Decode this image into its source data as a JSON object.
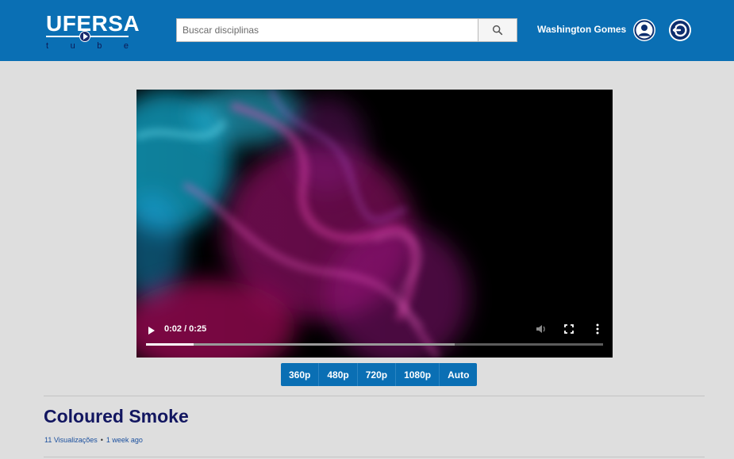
{
  "header": {
    "logo_text": "UFERSA",
    "logo_sub": [
      "t",
      "u",
      "b",
      "e"
    ],
    "search_placeholder": "Buscar disciplinas",
    "username": "Washington Gomes",
    "icons": {
      "search": "search-icon",
      "profile": "user-icon",
      "logout": "logout-icon"
    }
  },
  "player": {
    "time": "0:02 / 0:25",
    "progress": 0.104,
    "buffered": 0.675
  },
  "quality_options": [
    "360p",
    "480p",
    "720p",
    "1080p",
    "Auto"
  ],
  "video": {
    "title": "Coloured Smoke",
    "views": "11 Visualizações",
    "separator": "•",
    "posted": "1 week ago"
  },
  "colors": {
    "header": "#0a6fb4",
    "title": "#121660",
    "background": "#dedede"
  }
}
